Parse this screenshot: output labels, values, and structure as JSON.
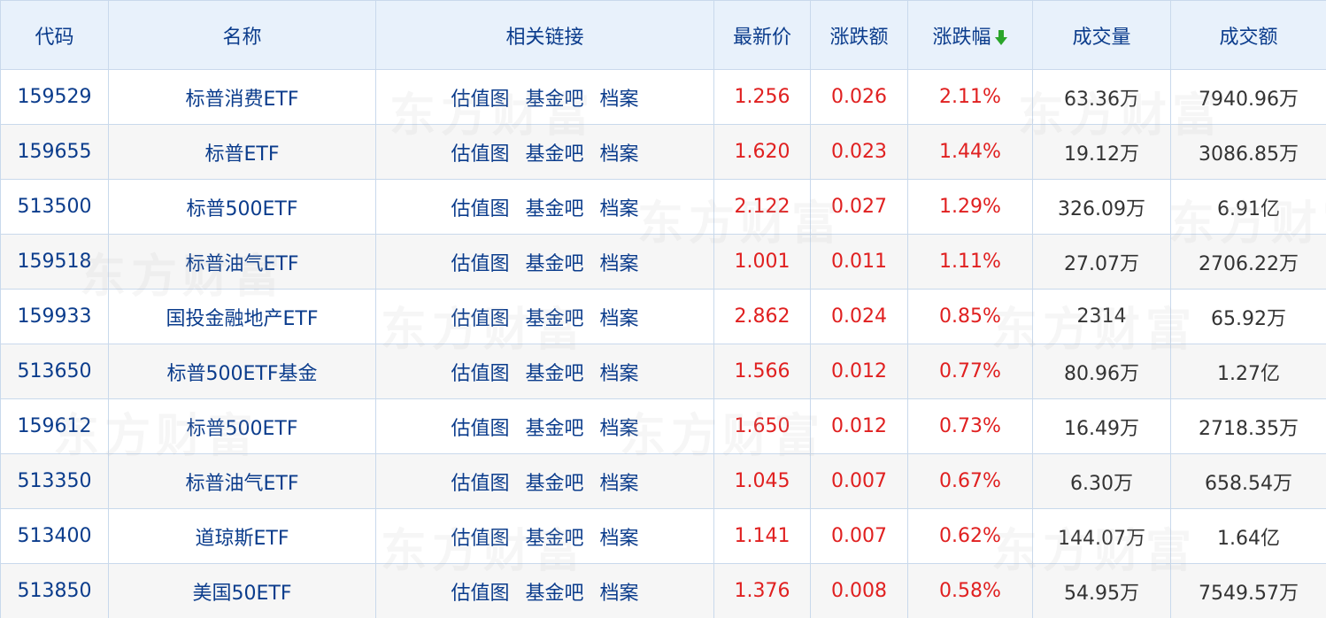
{
  "headers": {
    "code": "代码",
    "name": "名称",
    "links": "相关链接",
    "price": "最新价",
    "change": "涨跌额",
    "pct": "涨跌幅",
    "volume": "成交量",
    "amount": "成交额"
  },
  "sort_indicator": {
    "column": "pct",
    "direction": "desc",
    "icon": "arrow-down-icon",
    "color": "#2aa52a"
  },
  "link_labels": [
    "估值图",
    "基金吧",
    "档案"
  ],
  "watermark": "东方财富",
  "colors": {
    "header_bg": "#e8f1fb",
    "text_blue": "#0b3c8c",
    "up_red": "#e02020",
    "border": "#c9d9ec"
  },
  "rows": [
    {
      "code": "159529",
      "name": "标普消费ETF",
      "price": "1.256",
      "change": "0.026",
      "pct": "2.11%",
      "volume": "63.36万",
      "amount": "7940.96万"
    },
    {
      "code": "159655",
      "name": "标普ETF",
      "price": "1.620",
      "change": "0.023",
      "pct": "1.44%",
      "volume": "19.12万",
      "amount": "3086.85万"
    },
    {
      "code": "513500",
      "name": "标普500ETF",
      "price": "2.122",
      "change": "0.027",
      "pct": "1.29%",
      "volume": "326.09万",
      "amount": "6.91亿"
    },
    {
      "code": "159518",
      "name": "标普油气ETF",
      "price": "1.001",
      "change": "0.011",
      "pct": "1.11%",
      "volume": "27.07万",
      "amount": "2706.22万"
    },
    {
      "code": "159933",
      "name": "国投金融地产ETF",
      "price": "2.862",
      "change": "0.024",
      "pct": "0.85%",
      "volume": "2314",
      "amount": "65.92万"
    },
    {
      "code": "513650",
      "name": "标普500ETF基金",
      "price": "1.566",
      "change": "0.012",
      "pct": "0.77%",
      "volume": "80.96万",
      "amount": "1.27亿"
    },
    {
      "code": "159612",
      "name": "标普500ETF",
      "price": "1.650",
      "change": "0.012",
      "pct": "0.73%",
      "volume": "16.49万",
      "amount": "2718.35万"
    },
    {
      "code": "513350",
      "name": "标普油气ETF",
      "price": "1.045",
      "change": "0.007",
      "pct": "0.67%",
      "volume": "6.30万",
      "amount": "658.54万"
    },
    {
      "code": "513400",
      "name": "道琼斯ETF",
      "price": "1.141",
      "change": "0.007",
      "pct": "0.62%",
      "volume": "144.07万",
      "amount": "1.64亿"
    },
    {
      "code": "513850",
      "name": "美国50ETF",
      "price": "1.376",
      "change": "0.008",
      "pct": "0.58%",
      "volume": "54.95万",
      "amount": "7549.57万"
    }
  ]
}
